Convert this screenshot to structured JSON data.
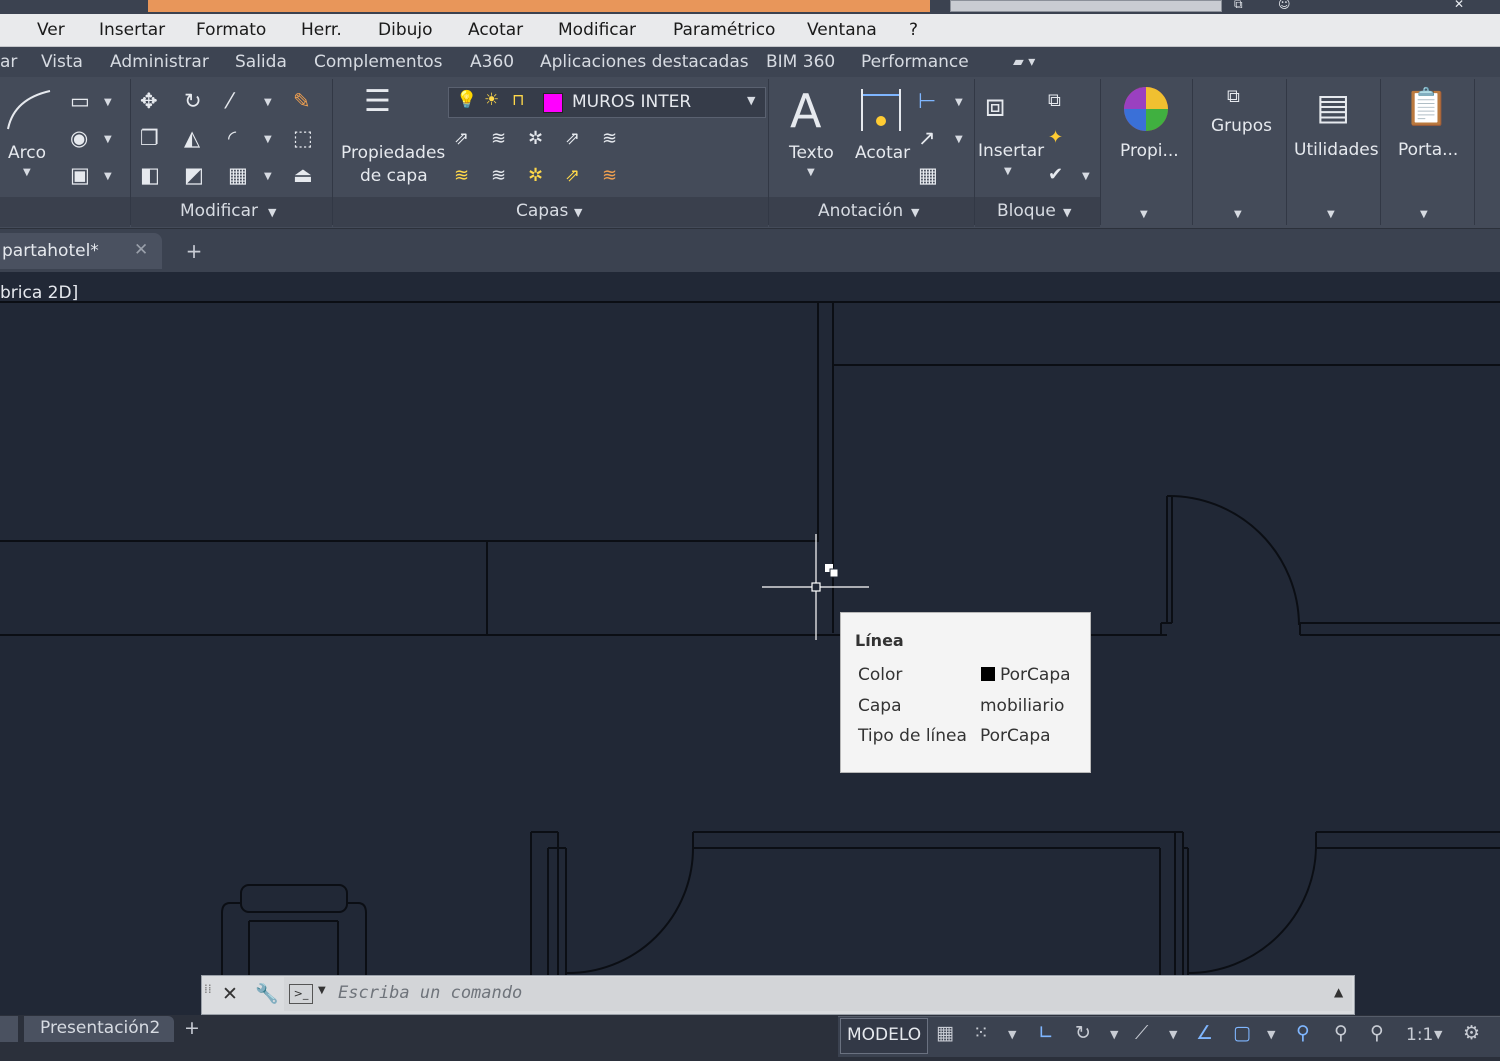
{
  "menu": {
    "items": [
      "Ver",
      "Insertar",
      "Formato",
      "Herr.",
      "Dibujo",
      "Acotar",
      "Modificar",
      "Paramétrico",
      "Ventana",
      "?"
    ]
  },
  "ribbon_tabs": {
    "items": [
      "ar",
      "Vista",
      "Administrar",
      "Salida",
      "Complementos",
      "A360",
      "Aplicaciones destacadas",
      "BIM 360",
      "Performance"
    ]
  },
  "ribbon": {
    "arco_label": "Arco",
    "modificar_panel": "Modificar",
    "propiedades_line1": "Propiedades",
    "propiedades_line2": "de capa",
    "layer_combo_value": "MUROS INTER",
    "layer_color": "#ff00ff",
    "capas_panel": "Capas",
    "texto_label": "Texto",
    "acotar_label": "Acotar",
    "anotacion_panel": "Anotación",
    "insertar_label": "Insertar",
    "bloque_panel": "Bloque",
    "propi_label": "Propi...",
    "grupos_label": "Grupos",
    "utilidades_label": "Utilidades",
    "porta_label": "Porta..."
  },
  "file_tabs": {
    "active": "partahotel*"
  },
  "viewport": {
    "label": "brica 2D]"
  },
  "tooltip": {
    "title": "Línea",
    "rows": [
      {
        "label": "Color",
        "value": "PorCapa"
      },
      {
        "label": "Capa",
        "value": "mobiliario"
      },
      {
        "label": "Tipo de línea",
        "value": "PorCapa"
      }
    ]
  },
  "command_line": {
    "placeholder": "Escriba un comando"
  },
  "status": {
    "layout_tab": "Presentación2",
    "model": "MODELO",
    "scale": "1:1"
  }
}
